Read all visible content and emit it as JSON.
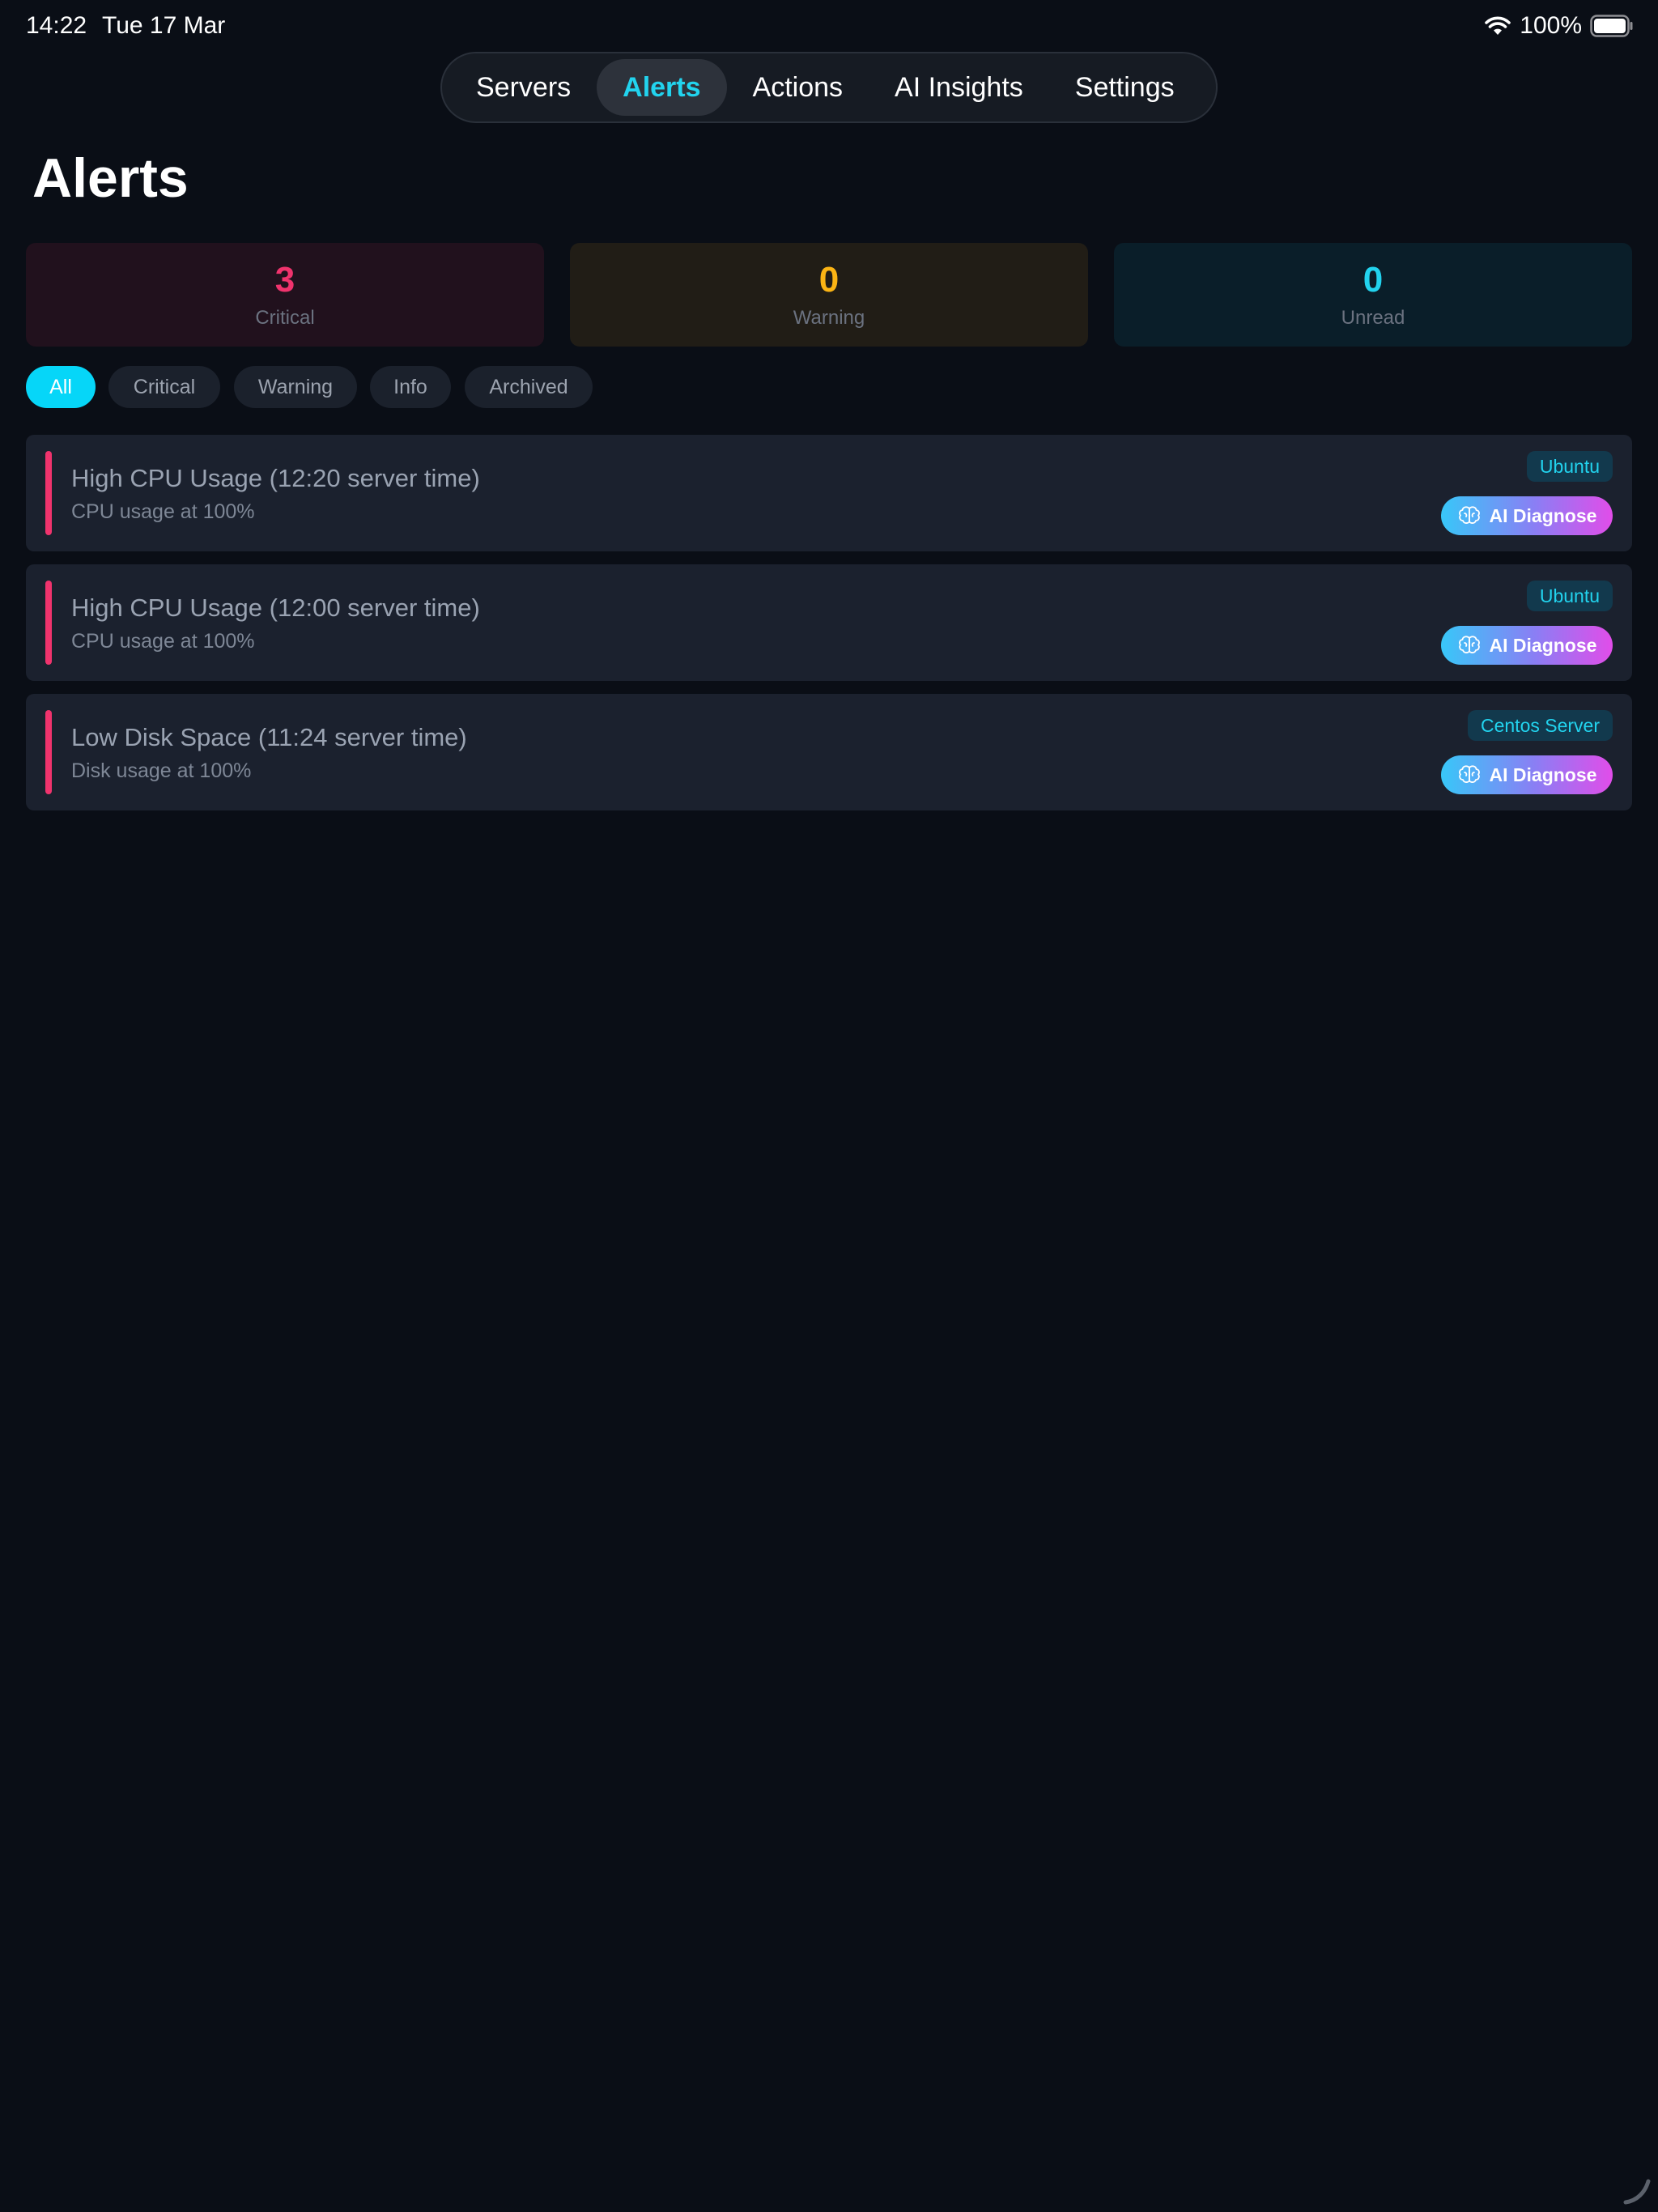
{
  "status_bar": {
    "time": "14:22",
    "date": "Tue 17 Mar",
    "battery": "100%"
  },
  "tabs": [
    {
      "label": "Servers",
      "active": false
    },
    {
      "label": "Alerts",
      "active": true
    },
    {
      "label": "Actions",
      "active": false
    },
    {
      "label": "AI Insights",
      "active": false
    },
    {
      "label": "Settings",
      "active": false
    }
  ],
  "page": {
    "title": "Alerts"
  },
  "summary": {
    "critical": {
      "count": "3",
      "label": "Critical",
      "color": "#f0336d"
    },
    "warning": {
      "count": "0",
      "label": "Warning",
      "color": "#fbb414"
    },
    "unread": {
      "count": "0",
      "label": "Unread",
      "color": "#22d3ee"
    }
  },
  "filters": [
    {
      "label": "All",
      "active": true
    },
    {
      "label": "Critical",
      "active": false
    },
    {
      "label": "Warning",
      "active": false
    },
    {
      "label": "Info",
      "active": false
    },
    {
      "label": "Archived",
      "active": false
    }
  ],
  "alerts": [
    {
      "title": "High CPU Usage (12:20 server time)",
      "description": "CPU usage at 100%",
      "server": "Ubuntu",
      "severity": "critical",
      "action_label": "AI Diagnose"
    },
    {
      "title": "High CPU Usage (12:00 server time)",
      "description": "CPU usage at 100%",
      "server": "Ubuntu",
      "severity": "critical",
      "action_label": "AI Diagnose"
    },
    {
      "title": "Low Disk Space (11:24 server time)",
      "description": "Disk usage at 100%",
      "server": "Centos Server",
      "severity": "critical",
      "action_label": "AI Diagnose"
    }
  ],
  "colors": {
    "accent": "#22d3ee",
    "critical": "#f0336d",
    "background": "#0a0e16"
  }
}
